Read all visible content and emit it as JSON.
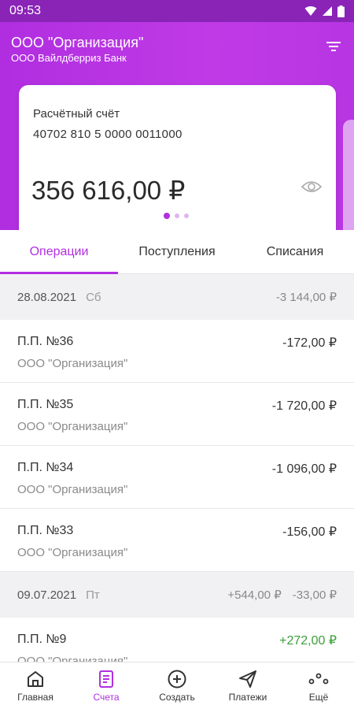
{
  "status_bar": {
    "time": "09:53"
  },
  "header": {
    "org_name": "ООО \"Организация\"",
    "bank_name": "ООО Вайлдберриз Банк"
  },
  "account_card": {
    "type": "Расчётный счёт",
    "number": "40702 810 5 0000 0011000",
    "balance": "356 616,00 ₽"
  },
  "tabs": [
    {
      "label": "Операции",
      "active": true
    },
    {
      "label": "Поступления",
      "active": false
    },
    {
      "label": "Списания",
      "active": false
    }
  ],
  "groups": [
    {
      "date": "28.08.2021",
      "weekday": "Сб",
      "income": "",
      "expense": "-3 144,00 ₽",
      "operations": [
        {
          "title": "П.П. №36",
          "counterparty": "ООО \"Организация\"",
          "amount": "-172,00 ₽"
        },
        {
          "title": "П.П. №35",
          "counterparty": "ООО \"Организация\"",
          "amount": "-1 720,00 ₽"
        },
        {
          "title": "П.П. №34",
          "counterparty": "ООО \"Организация\"",
          "amount": "-1 096,00 ₽"
        },
        {
          "title": "П.П. №33",
          "counterparty": "ООО \"Организация\"",
          "amount": "-156,00 ₽"
        }
      ]
    },
    {
      "date": "09.07.2021",
      "weekday": "Пт",
      "income": "+544,00 ₽",
      "expense": "-33,00 ₽",
      "operations": [
        {
          "title": "П.П. №9",
          "counterparty": "ООО \"Организация\"",
          "amount": "+272,00 ₽"
        }
      ]
    }
  ],
  "bottom_nav": [
    {
      "label": "Главная",
      "icon": "home-icon",
      "active": false
    },
    {
      "label": "Счета",
      "icon": "document-icon",
      "active": true
    },
    {
      "label": "Создать",
      "icon": "plus-circle-icon",
      "active": false
    },
    {
      "label": "Платежи",
      "icon": "send-icon",
      "active": false
    },
    {
      "label": "Ещё",
      "icon": "more-icon",
      "active": false
    }
  ],
  "colors": {
    "accent": "#b12fe0",
    "header": "#b02ee0",
    "positive": "#3ba03b"
  }
}
